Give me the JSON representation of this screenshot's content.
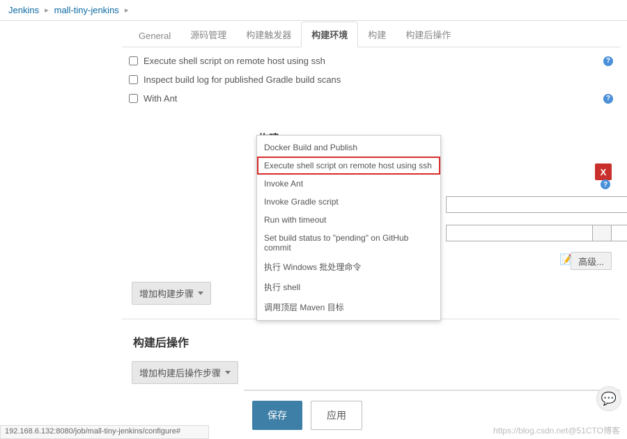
{
  "breadcrumb": {
    "root": "Jenkins",
    "project": "mall-tiny-jenkins"
  },
  "tabs": {
    "general": "General",
    "scm": "源码管理",
    "triggers": "构建触发器",
    "env": "构建环境",
    "build": "构建",
    "post": "构建后操作"
  },
  "env_checks": {
    "ssh": "Execute shell script on remote host using ssh",
    "gradle_scans": "Inspect build log for published Gradle build scans",
    "with_ant": "With Ant"
  },
  "build_section_title": "构建",
  "dropdown": {
    "items": [
      "Docker Build and Publish",
      "Execute shell script on remote host using ssh",
      "Invoke Ant",
      "Invoke Gradle script",
      "Run with timeout",
      "Set build status to \"pending\" on GitHub commit",
      "执行 Windows 批处理命令",
      "执行 shell",
      "调用顶层 Maven 目标"
    ]
  },
  "buttons": {
    "add_build_step": "增加构建步骤",
    "add_post_build_step": "增加构建后操作步骤",
    "advanced": "高级...",
    "save": "保存",
    "apply": "应用",
    "close_x": "X"
  },
  "post_build_title": "构建后操作",
  "status_url": "192.168.6.132:8080/job/mall-tiny-jenkins/configure#",
  "watermark": "https://blog.csdn.net@51CTO博客"
}
